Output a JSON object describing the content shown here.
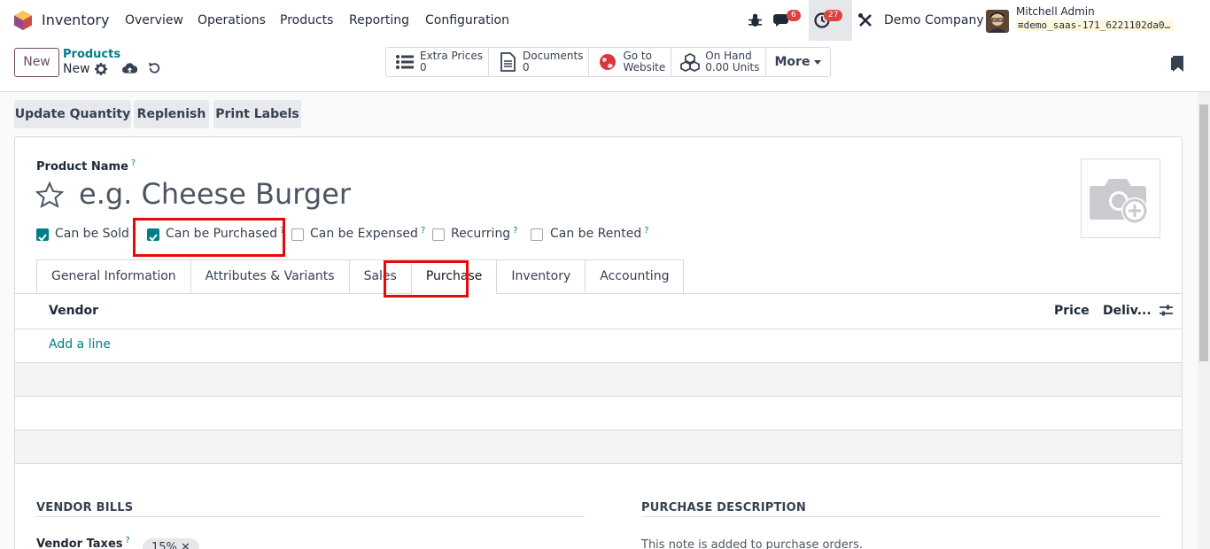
{
  "topnav": {
    "app_name": "Inventory",
    "menu": [
      "Overview",
      "Operations",
      "Products",
      "Reporting",
      "Configuration"
    ],
    "messages_count": "6",
    "activities_count": "27",
    "company": "Demo Company",
    "user_name": "Mitchell Admin",
    "database": "demo_saas-171_6221102da0…"
  },
  "control_panel": {
    "new_label": "New",
    "breadcrumb_parent": "Products",
    "breadcrumb_current": "New",
    "smart_buttons": [
      {
        "label": "Extra Prices",
        "value": "0",
        "icon": "list-icon"
      },
      {
        "label": "Documents",
        "value": "0",
        "icon": "document-icon"
      },
      {
        "label": "Go to",
        "value": "Website",
        "icon": "globe-icon"
      },
      {
        "label": "On Hand",
        "value": "0.00 Units",
        "icon": "cubes-icon"
      }
    ],
    "more_label": "More"
  },
  "actions": [
    "Update Quantity",
    "Replenish",
    "Print Labels"
  ],
  "form": {
    "product_name_label": "Product Name",
    "help_mark": "?",
    "product_name_placeholder": "e.g. Cheese Burger",
    "checkboxes": [
      {
        "label": "Can be Sold",
        "checked": true
      },
      {
        "label": "Can be Purchased",
        "checked": true
      },
      {
        "label": "Can be Expensed",
        "checked": false
      },
      {
        "label": "Recurring",
        "checked": false
      },
      {
        "label": "Can be Rented",
        "checked": false
      }
    ],
    "tabs": [
      "General Information",
      "Attributes & Variants",
      "Sales",
      "Purchase",
      "Inventory",
      "Accounting"
    ],
    "active_tab": "Purchase",
    "vendor_table": {
      "columns": [
        "Vendor",
        "Price",
        "Deliv..."
      ],
      "add_line": "Add a line"
    },
    "vendor_bills_title": "VENDOR BILLS",
    "vendor_taxes_label": "Vendor Taxes",
    "vendor_tax_tag": "15%",
    "purchase_description_title": "PURCHASE DESCRIPTION",
    "purchase_description_placeholder": "This note is added to purchase orders."
  },
  "colors": {
    "brand": "#714b67",
    "accent": "#017e84",
    "highlight": "#e8090c"
  }
}
